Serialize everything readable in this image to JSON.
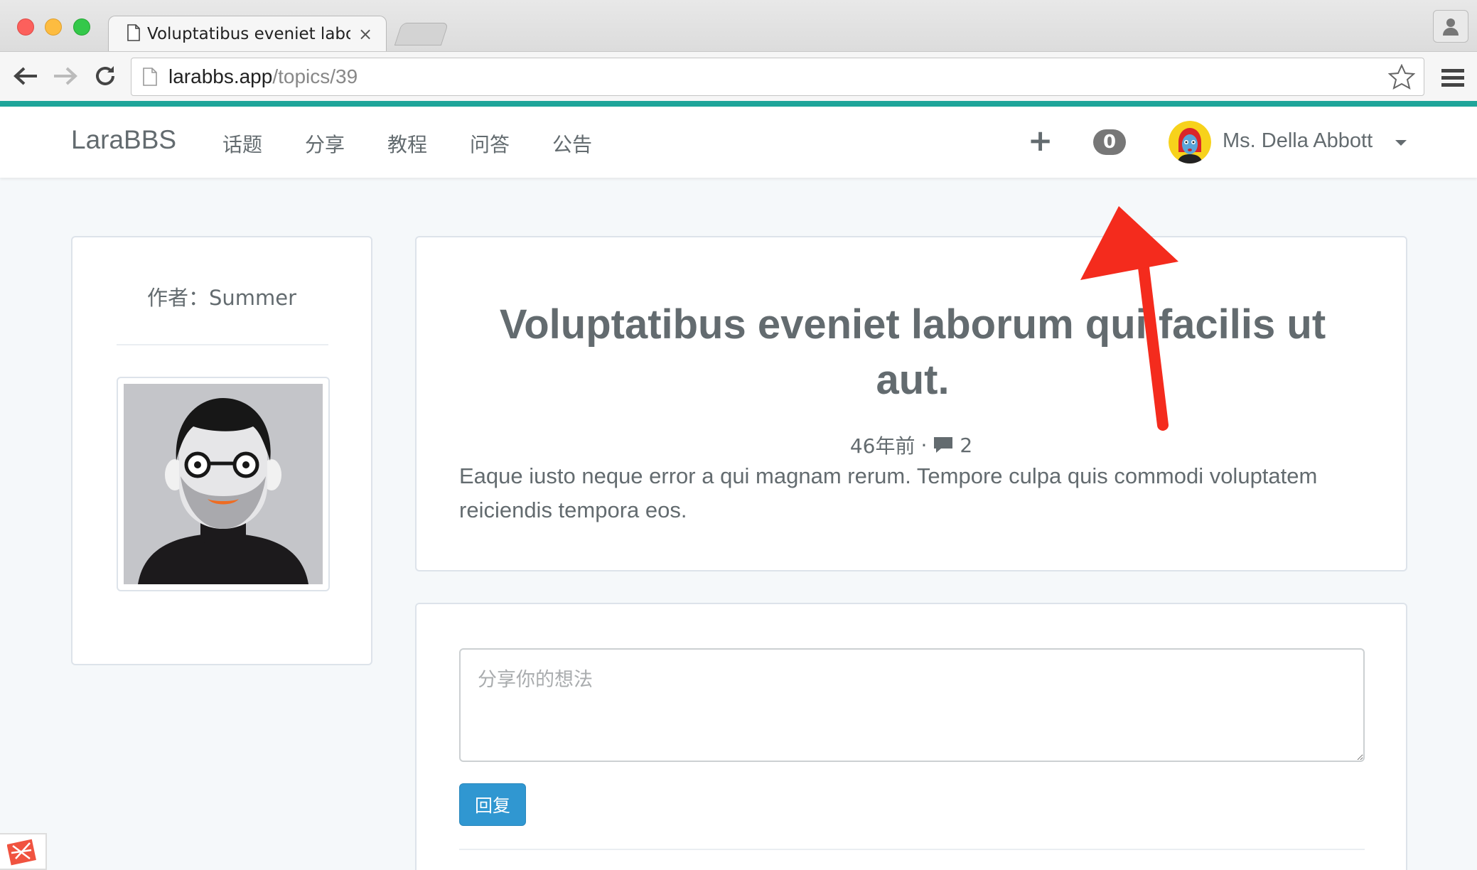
{
  "browser": {
    "tab_title": "Voluptatibus eveniet laboru",
    "tab_close": "×",
    "url_host": "larabbs.app",
    "url_path": "/topics/39"
  },
  "navbar": {
    "brand": "LaraBBS",
    "links": [
      "话题",
      "分享",
      "教程",
      "问答",
      "公告"
    ],
    "create_icon": "+",
    "notification_count": "0",
    "username": "Ms. Della Abbott"
  },
  "author": {
    "label": "作者：Summer"
  },
  "topic": {
    "title": "Voluptatibus eveniet laborum qui facilis ut aut.",
    "time_ago": "46年前",
    "separator": "·",
    "reply_count": "2",
    "body": "Eaque iusto neque error a qui magnam rerum. Tempore culpa quis commodi voluptatem reiciendis tempora eos."
  },
  "reply": {
    "placeholder": "分享你的想法",
    "submit_label": "回复"
  },
  "colors": {
    "accent": "#1fa59a",
    "primary_button": "#3097d1",
    "annotation_arrow": "#f42b1d"
  }
}
